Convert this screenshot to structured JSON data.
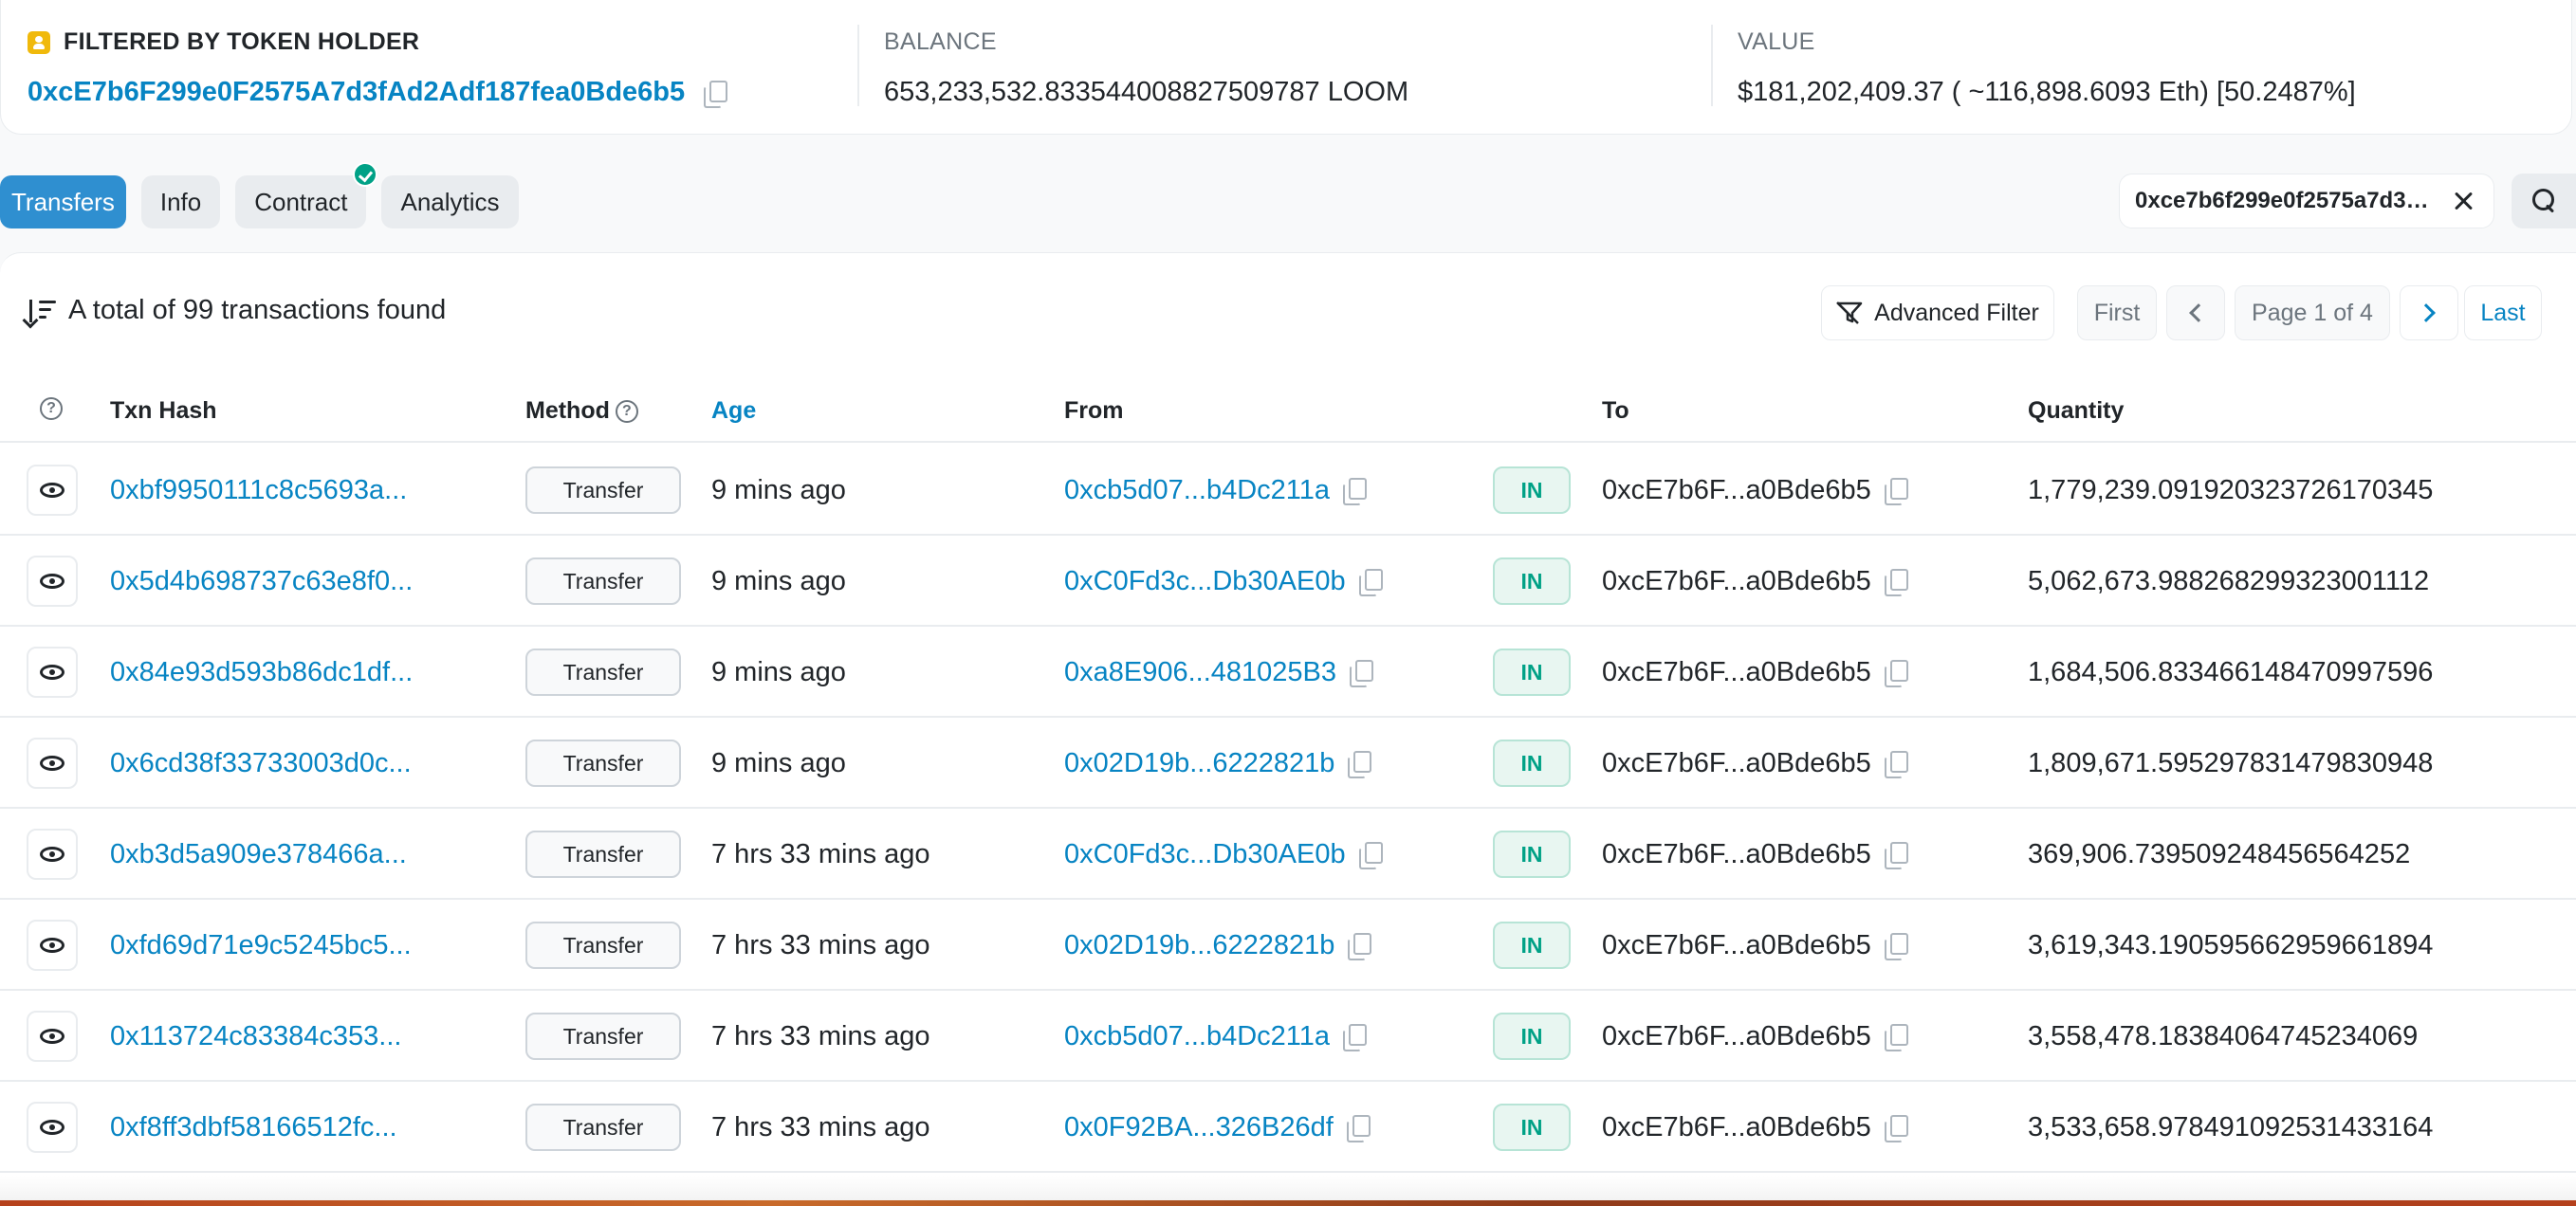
{
  "summary": {
    "holder_label": "FILTERED BY TOKEN HOLDER",
    "holder_address": "0xcE7b6F299e0F2575A7d3fAd2Adf187fea0Bde6b5",
    "balance_label": "BALANCE",
    "balance_value": "653,233,532.833544008827509787 LOOM",
    "value_label": "VALUE",
    "value_value": "$181,202,409.37 ( ~116,898.6093 Eth) [50.2487%]"
  },
  "tabs": [
    {
      "label": "Transfers",
      "active": true
    },
    {
      "label": "Info",
      "active": false
    },
    {
      "label": "Contract",
      "active": false,
      "verified": true
    },
    {
      "label": "Analytics",
      "active": false
    }
  ],
  "search_chip": {
    "text": "0xce7b6f299e0f2575a7d3f..."
  },
  "table": {
    "count_text": "A total of 99 transactions found",
    "advanced_filter_label": "Advanced Filter",
    "pager": {
      "first": "First",
      "page": "Page 1 of 4",
      "last": "Last"
    },
    "headers": {
      "txn_hash": "Txn Hash",
      "method": "Method",
      "age": "Age",
      "from": "From",
      "to": "To",
      "quantity": "Quantity"
    },
    "rows": [
      {
        "hash": "0xbf9950111c8c5693a...",
        "method": "Transfer",
        "age": "9 mins ago",
        "from": "0xcb5d07...b4Dc211a",
        "dir": "IN",
        "to": "0xcE7b6F...a0Bde6b5",
        "quantity": "1,779,239.091920323726170345"
      },
      {
        "hash": "0x5d4b698737c63e8f0...",
        "method": "Transfer",
        "age": "9 mins ago",
        "from": "0xC0Fd3c...Db30AE0b",
        "dir": "IN",
        "to": "0xcE7b6F...a0Bde6b5",
        "quantity": "5,062,673.988268299323001112"
      },
      {
        "hash": "0x84e93d593b86dc1df...",
        "method": "Transfer",
        "age": "9 mins ago",
        "from": "0xa8E906...481025B3",
        "dir": "IN",
        "to": "0xcE7b6F...a0Bde6b5",
        "quantity": "1,684,506.833466148470997596"
      },
      {
        "hash": "0x6cd38f33733003d0c...",
        "method": "Transfer",
        "age": "9 mins ago",
        "from": "0x02D19b...6222821b",
        "dir": "IN",
        "to": "0xcE7b6F...a0Bde6b5",
        "quantity": "1,809,671.595297831479830948"
      },
      {
        "hash": "0xb3d5a909e378466a...",
        "method": "Transfer",
        "age": "7 hrs 33 mins ago",
        "from": "0xC0Fd3c...Db30AE0b",
        "dir": "IN",
        "to": "0xcE7b6F...a0Bde6b5",
        "quantity": "369,906.739509248456564252"
      },
      {
        "hash": "0xfd69d71e9c5245bc5...",
        "method": "Transfer",
        "age": "7 hrs 33 mins ago",
        "from": "0x02D19b...6222821b",
        "dir": "IN",
        "to": "0xcE7b6F...a0Bde6b5",
        "quantity": "3,619,343.190595662959661894"
      },
      {
        "hash": "0x113724c83384c353...",
        "method": "Transfer",
        "age": "7 hrs 33 mins ago",
        "from": "0xcb5d07...b4Dc211a",
        "dir": "IN",
        "to": "0xcE7b6F...a0Bde6b5",
        "quantity": "3,558,478.18384064745234069"
      },
      {
        "hash": "0xf8ff3dbf58166512fc...",
        "method": "Transfer",
        "age": "7 hrs 33 mins ago",
        "from": "0x0F92BA...326B26df",
        "dir": "IN",
        "to": "0xcE7b6F...a0Bde6b5",
        "quantity": "3,533,658.978491092531433164"
      }
    ]
  },
  "colors": {
    "link": "#0784c3",
    "active_tab": "#2f8fd0",
    "in_badge": "#00a186"
  }
}
